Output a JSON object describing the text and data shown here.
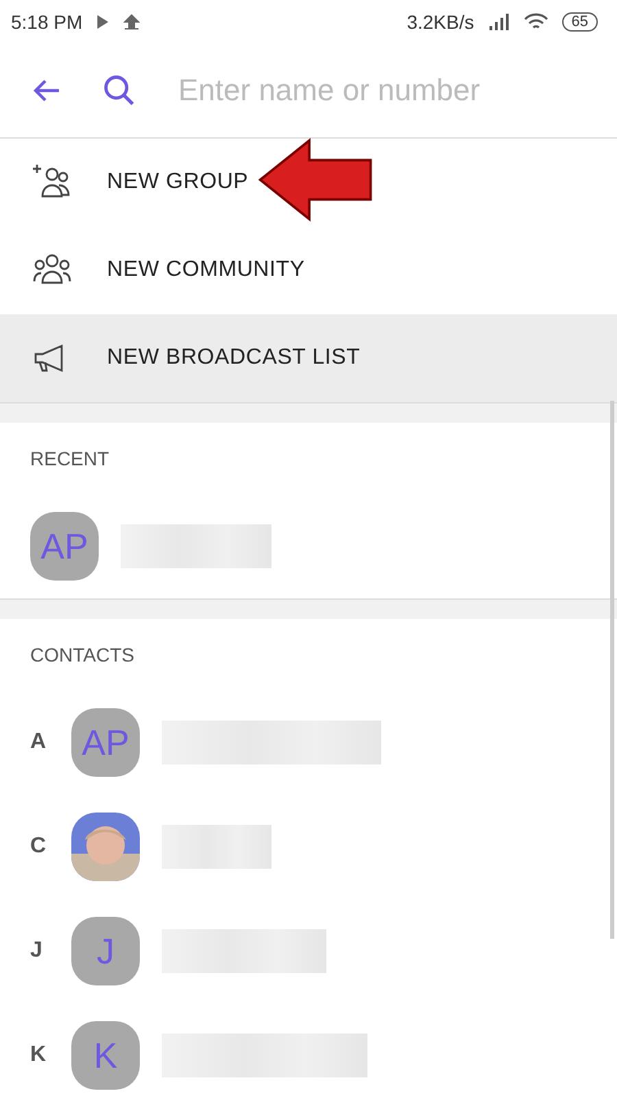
{
  "status_bar": {
    "time": "5:18 PM",
    "speed": "3.2KB/s",
    "battery": "65"
  },
  "search": {
    "placeholder": "Enter name or number"
  },
  "actions": [
    {
      "kind": "group",
      "label": "NEW GROUP",
      "highlighted": false
    },
    {
      "kind": "community",
      "label": "NEW COMMUNITY",
      "highlighted": false
    },
    {
      "kind": "broadcast",
      "label": "NEW BROADCAST LIST",
      "highlighted": true
    }
  ],
  "recent": {
    "title": "RECENT",
    "items": [
      {
        "kind": "initials",
        "initials": "AP"
      }
    ]
  },
  "contacts": {
    "title": "CONTACTS",
    "items": [
      {
        "letter": "A",
        "kind": "initials",
        "initials": "AP"
      },
      {
        "letter": "C",
        "kind": "picture"
      },
      {
        "letter": "J",
        "kind": "initials",
        "initials": "J"
      },
      {
        "letter": "K",
        "kind": "initials",
        "initials": "K"
      }
    ]
  }
}
